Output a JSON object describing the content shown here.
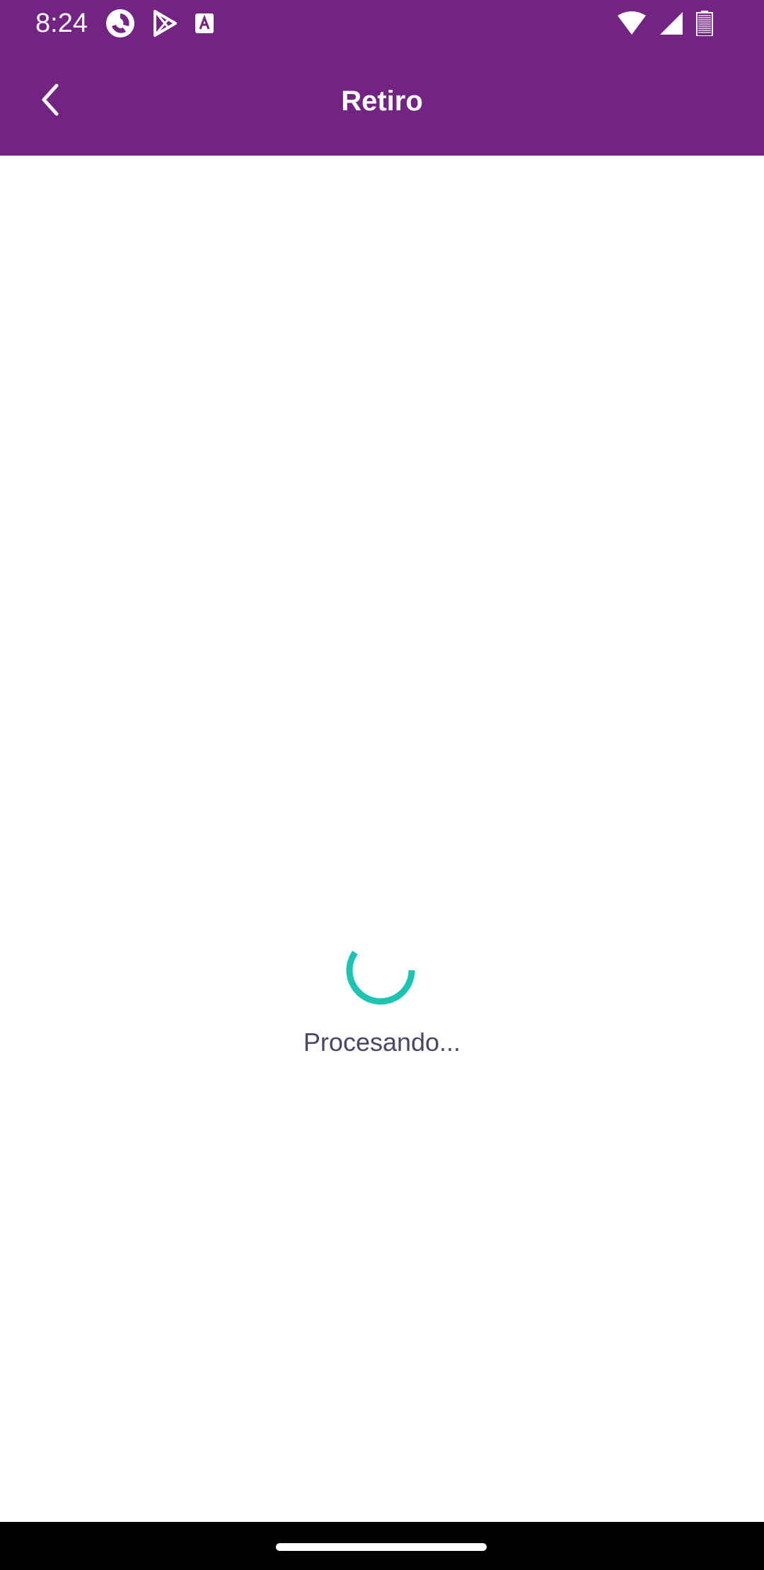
{
  "status_bar": {
    "time": "8:24",
    "left_icons": [
      "app-swirl-icon",
      "play-store-icon",
      "text-a-icon"
    ],
    "right_icons": [
      "wifi-icon",
      "cell-signal-icon",
      "battery-icon"
    ],
    "background_color": "#732382"
  },
  "app_bar": {
    "title": "Retiro",
    "back_icon": "chevron-left-icon",
    "background_color": "#732382"
  },
  "main": {
    "loading_text": "Procesando...",
    "spinner_color": "#1cc5b3",
    "text_color": "#4b4566"
  }
}
